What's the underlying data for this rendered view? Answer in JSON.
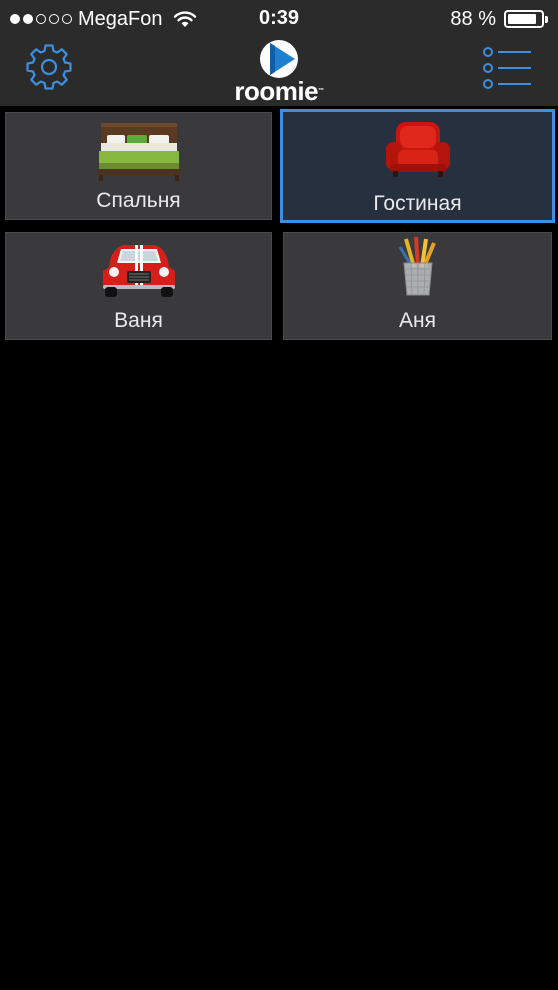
{
  "status_bar": {
    "carrier": "MegaFon",
    "time": "0:39",
    "battery_percent": "88 %",
    "battery_level": 0.88,
    "signal_filled": 2,
    "signal_total": 5
  },
  "header": {
    "logo_text": "roomie",
    "logo_tm": "™",
    "settings_icon": "gear-icon",
    "menu_icon": "list-icon",
    "accent_color": "#3d8fe0"
  },
  "rooms": [
    {
      "label": "Спальня",
      "icon": "bed-icon",
      "selected": false
    },
    {
      "label": "Гостиная",
      "icon": "armchair-icon",
      "selected": true
    },
    {
      "label": "Ваня",
      "icon": "car-icon",
      "selected": false
    },
    {
      "label": "Аня",
      "icon": "pencil-cup-icon",
      "selected": false
    }
  ]
}
